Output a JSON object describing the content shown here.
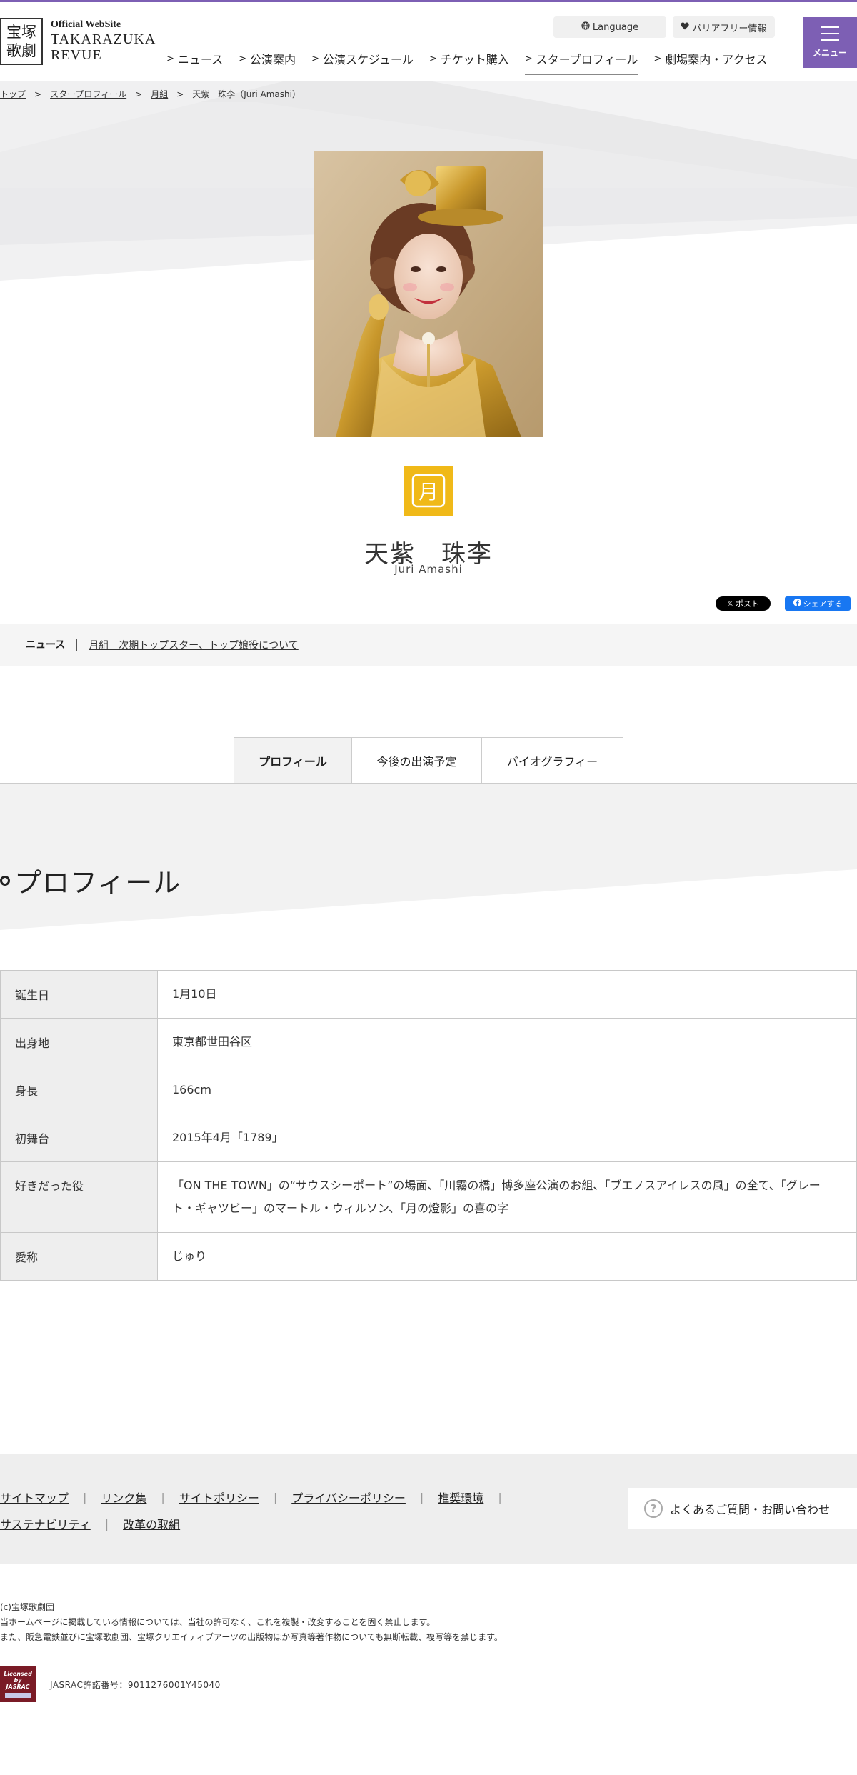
{
  "header": {
    "logo_kanji": "宝塚歌劇",
    "logo_official": "Official WebSite",
    "logo_name_line1": "TAKARAZUKA",
    "logo_name_line2": "REVUE",
    "language_label": "Language",
    "barrier_free_label": "バリアフリー情報",
    "menu_label": "メニュー",
    "nav": [
      {
        "label": "ニュース"
      },
      {
        "label": "公演案内"
      },
      {
        "label": "公演スケジュール"
      },
      {
        "label": "チケット購入"
      },
      {
        "label": "スタープロフィール"
      },
      {
        "label": "劇場案内・アクセス"
      }
    ]
  },
  "breadcrumb": {
    "items": [
      "トップ",
      "スタープロフィール",
      "月組"
    ],
    "current": "天紫　珠李（Juri Amashi）"
  },
  "star": {
    "name": "天紫　珠李",
    "roman": "Juri Amashi",
    "troupe_color": "#f0b918"
  },
  "share": {
    "x_label": "ポスト",
    "fb_label": "シェアする"
  },
  "news": {
    "label": "ニュース",
    "link": "月組　次期トップスター、トップ娘役について"
  },
  "tabs": [
    {
      "label": "プロフィール"
    },
    {
      "label": "今後の出演予定"
    },
    {
      "label": "バイオグラフィー"
    }
  ],
  "profile": {
    "title": "プロフィール",
    "rows": [
      {
        "key": "誕生日",
        "value": "1月10日"
      },
      {
        "key": "出身地",
        "value": "東京都世田谷区"
      },
      {
        "key": "身長",
        "value": "166cm"
      },
      {
        "key": "初舞台",
        "value": "2015年4月「1789」"
      },
      {
        "key": "好きだった役",
        "value": "「ON THE TOWN」の“サウスシーポート”の場面、「川霧の橋」博多座公演のお組、「ブエノスアイレスの風」の全て、「グレート・ギャツビー」のマートル・ウィルソン、「月の燈影」の喜の字"
      },
      {
        "key": "愛称",
        "value": "じゅり"
      }
    ]
  },
  "footer": {
    "links_row1": [
      "サイトマップ",
      "リンク集",
      "サイトポリシー",
      "プライバシーポリシー",
      "推奨環境"
    ],
    "links_row2": [
      "サステナビリティ",
      "改革の取組"
    ],
    "faq_label": "よくあるご質問・お問い合わせ",
    "copyright": "(c)宝塚歌劇団",
    "notice1": "当ホームページに掲載している情報については、当社の許可なく、これを複製・改変することを固く禁止します。",
    "notice2": "また、阪急電鉄並びに宝塚歌劇団、宝塚クリエイティブアーツの出版物ほか写真等著作物についても無断転載、複写等を禁じます。",
    "jasrac_logo_text": "Licensed by JASRAC",
    "jasrac_number": "JASRAC許諾番号：9011276001Y45040"
  },
  "colors": {
    "brand_purple": "#7d5fb4",
    "troupe_yellow": "#f0b918",
    "facebook_blue": "#1877f2"
  }
}
